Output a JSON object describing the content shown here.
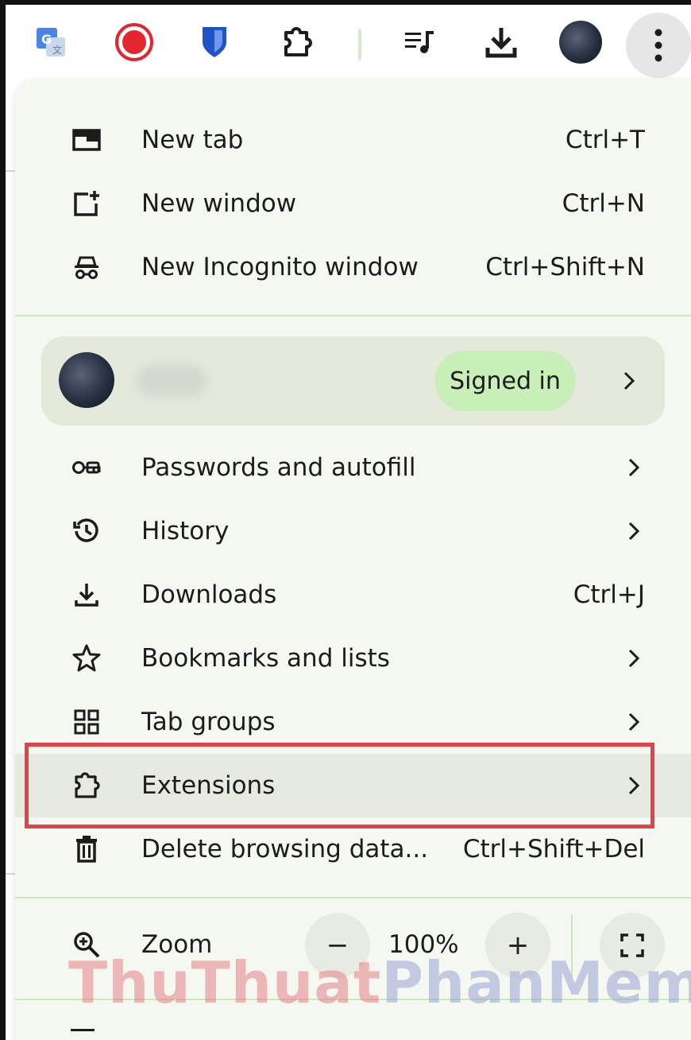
{
  "toolbar": {
    "icons": [
      "google-translate-icon",
      "record-icon",
      "bitwarden-shield-icon",
      "extensions-puzzle-icon",
      "media-queue-icon",
      "download-icon",
      "profile-avatar-icon",
      "more-vertical-icon"
    ]
  },
  "menu": {
    "items_top": [
      {
        "label": "New tab",
        "shortcut": "Ctrl+T",
        "icon": "new-tab-icon"
      },
      {
        "label": "New window",
        "shortcut": "Ctrl+N",
        "icon": "new-window-icon"
      },
      {
        "label": "New Incognito window",
        "shortcut": "Ctrl+Shift+N",
        "icon": "incognito-icon"
      }
    ],
    "profile": {
      "signed_in_label": "Signed in"
    },
    "items_main": [
      {
        "label": "Passwords and autofill",
        "icon": "key-icon"
      },
      {
        "label": "History",
        "icon": "history-icon"
      },
      {
        "label": "Downloads",
        "shortcut": "Ctrl+J",
        "icon": "download-icon"
      },
      {
        "label": "Bookmarks and lists",
        "icon": "star-icon"
      },
      {
        "label": "Tab groups",
        "icon": "tab-groups-icon"
      },
      {
        "label": "Extensions",
        "icon": "puzzle-icon"
      },
      {
        "label": "Delete browsing data...",
        "shortcut": "Ctrl+Shift+Del",
        "icon": "trash-icon"
      }
    ],
    "zoom": {
      "label": "Zoom",
      "level": "100%",
      "minus": "−",
      "plus": "+"
    }
  },
  "watermark": {
    "part1": "ThuThuat",
    "part2": "PhanMem.vn"
  },
  "colors": {
    "menu_bg": "#f5f8f0",
    "signed_in_pill": "#c9efb9",
    "highlight": "#e2434b",
    "divider": "#c9e6bd"
  }
}
